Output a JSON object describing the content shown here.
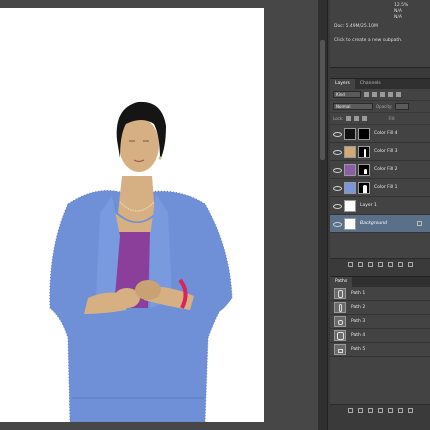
{
  "info_panel": {
    "doc_label": "Doc: 5.49M/25.10M",
    "hint": "Click to create a new subpath.",
    "values": [
      "12.5%",
      "N/A",
      "N/A",
      "0"
    ]
  },
  "layers_panel": {
    "tabs": [
      "Layers",
      "Channels"
    ],
    "kind_label": "Kind",
    "blend_mode": "Normal",
    "opacity_label": "Opacity:",
    "lock_label": "Lock:",
    "fill_label": "Fill:",
    "layers": [
      {
        "name": "Color Fill 4",
        "swatch": "#111111",
        "has_mask": true
      },
      {
        "name": "Color Fill 3",
        "swatch": "#d4a977",
        "has_mask": true
      },
      {
        "name": "Color Fill 2",
        "swatch": "#8a5fa6",
        "has_mask": true
      },
      {
        "name": "Color Fill 1",
        "swatch": "#7a95d9",
        "has_mask": true
      },
      {
        "name": "Layer 1",
        "swatch": "#ffffff",
        "has_mask": false
      },
      {
        "name": "Background",
        "swatch": "#ffffff",
        "has_mask": false
      }
    ],
    "selected_layer": "Background"
  },
  "paths_panel": {
    "title": "Paths",
    "paths": [
      "Path 1",
      "Path 2",
      "Path 3",
      "Path 4",
      "Path 5"
    ]
  },
  "colors": {
    "jacket": "#6f8fd6",
    "jacket_dark": "#5a79c2",
    "top": "#8b3f9a",
    "skin": "#d6b082",
    "hair": "#151515",
    "bracelet": "#d8245c",
    "selected_layer": "#5a6f88"
  }
}
